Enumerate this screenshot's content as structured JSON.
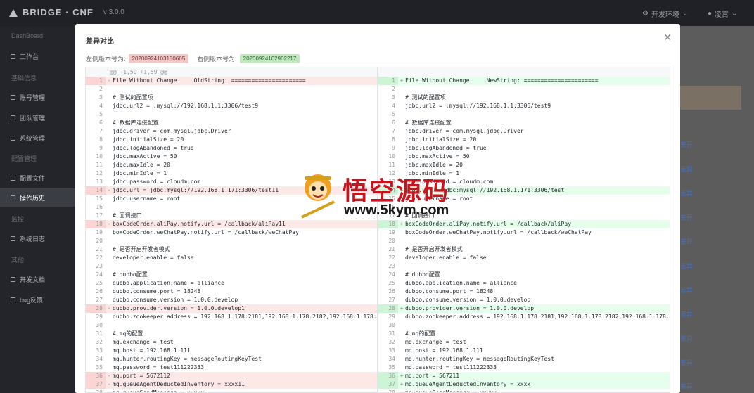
{
  "app": {
    "name": "BRIDGE · CNF",
    "version": "v 3.0.0"
  },
  "topbar": {
    "env_label": "开发环境",
    "user_label": "凌霄"
  },
  "sidebar": {
    "groups": [
      {
        "label": "DashBoard",
        "items": [
          {
            "label": "工作台",
            "icon": "desktop-icon"
          }
        ]
      },
      {
        "label": "基础信息",
        "items": [
          {
            "label": "账号管理",
            "icon": "user-icon"
          },
          {
            "label": "团队管理",
            "icon": "team-icon"
          },
          {
            "label": "系统管理",
            "icon": "file-icon"
          }
        ]
      },
      {
        "label": "配置管理",
        "items": [
          {
            "label": "配置文件",
            "icon": "folder-icon"
          },
          {
            "label": "操作历史",
            "icon": "history-icon",
            "active": true
          }
        ]
      },
      {
        "label": "监控",
        "items": [
          {
            "label": "系统日志",
            "icon": "log-icon"
          }
        ]
      },
      {
        "label": "其他",
        "items": [
          {
            "label": "开发文档",
            "icon": "book-icon"
          },
          {
            "label": "bug反馈",
            "icon": "bug-icon"
          }
        ]
      }
    ]
  },
  "background": {
    "link_label": "差异"
  },
  "modal": {
    "title": "差异对比",
    "left_label": "左侧版本号为:",
    "left_version": "20200924103150665",
    "right_label": "右侧版本号为:",
    "right_version": "20200924102902217",
    "hunk_header": "@@ -1,59 +1,59 @@"
  },
  "diff": {
    "left": [
      {
        "n": "1",
        "t": "del",
        "c": "File Without Change     OldString: ======================"
      },
      {
        "n": "2",
        "t": "ctx",
        "c": ""
      },
      {
        "n": "3",
        "t": "ctx",
        "c": "# 测试的配置项"
      },
      {
        "n": "4",
        "t": "ctx",
        "c": "jdbc.url2 = :mysql://192.168.1.1:3306/test9"
      },
      {
        "n": "5",
        "t": "ctx",
        "c": ""
      },
      {
        "n": "6",
        "t": "ctx",
        "c": "# 数据库连接配置"
      },
      {
        "n": "7",
        "t": "ctx",
        "c": "jdbc.driver = com.mysql.jdbc.Driver"
      },
      {
        "n": "8",
        "t": "ctx",
        "c": "jdbc.initialSize = 20"
      },
      {
        "n": "9",
        "t": "ctx",
        "c": "jdbc.logAbandoned = true"
      },
      {
        "n": "10",
        "t": "ctx",
        "c": "jdbc.maxActive = 50"
      },
      {
        "n": "11",
        "t": "ctx",
        "c": "jdbc.maxIdle = 20"
      },
      {
        "n": "12",
        "t": "ctx",
        "c": "jdbc.minIdle = 1"
      },
      {
        "n": "13",
        "t": "ctx",
        "c": "jdbc.password = cloudm.com"
      },
      {
        "n": "14",
        "t": "del",
        "c": "jdbc.url = jdbc:mysql://192.168.1.171:3306/test11"
      },
      {
        "n": "15",
        "t": "ctx",
        "c": "jdbc.username = root"
      },
      {
        "n": "16",
        "t": "ctx",
        "c": ""
      },
      {
        "n": "17",
        "t": "ctx",
        "c": "# 回调接口"
      },
      {
        "n": "18",
        "t": "del",
        "c": "boxCodeOrder.aliPay.notify.url = /callback/aliPay11"
      },
      {
        "n": "19",
        "t": "ctx",
        "c": "boxCodeOrder.weChatPay.notify.url = /callback/weChatPay"
      },
      {
        "n": "20",
        "t": "ctx",
        "c": ""
      },
      {
        "n": "21",
        "t": "ctx",
        "c": "# 是否开启开发者模式"
      },
      {
        "n": "22",
        "t": "ctx",
        "c": "developer.enable = false"
      },
      {
        "n": "23",
        "t": "ctx",
        "c": ""
      },
      {
        "n": "24",
        "t": "ctx",
        "c": "# dubbo配置"
      },
      {
        "n": "25",
        "t": "ctx",
        "c": "dubbo.application.name = alliance"
      },
      {
        "n": "26",
        "t": "ctx",
        "c": "dubbo.consume.port = 18248"
      },
      {
        "n": "27",
        "t": "ctx",
        "c": "dubbo.consume.version = 1.0.0.develop"
      },
      {
        "n": "28",
        "t": "del",
        "c": "dubbo.provider.version = 1.0.0.develop1"
      },
      {
        "n": "29",
        "t": "ctx",
        "c": "dubbo.zookeeper.address = 192.168.1.178:2181,192.168.1.178:2182,192.168.1.178:2"
      },
      {
        "n": "30",
        "t": "ctx",
        "c": ""
      },
      {
        "n": "31",
        "t": "ctx",
        "c": "# mq的配置"
      },
      {
        "n": "32",
        "t": "ctx",
        "c": "mq.exchange = test"
      },
      {
        "n": "33",
        "t": "ctx",
        "c": "mq.host = 192.168.1.111"
      },
      {
        "n": "34",
        "t": "ctx",
        "c": "mq.hunter.routingKey = messageRoutingKeyTest"
      },
      {
        "n": "35",
        "t": "ctx",
        "c": "mq.password = test111222333"
      },
      {
        "n": "36",
        "t": "del",
        "c": "mq.port = 5672112"
      },
      {
        "n": "37",
        "t": "del",
        "c": "mq.queueAgentDeductedInventory = xxxx11"
      },
      {
        "n": "38",
        "t": "ctx",
        "c": "mq.queueSendMessage = xxxxx"
      }
    ],
    "right": [
      {
        "n": "1",
        "t": "add",
        "c": "File Without Change     NewString: ======================"
      },
      {
        "n": "2",
        "t": "ctx",
        "c": ""
      },
      {
        "n": "3",
        "t": "ctx",
        "c": "# 测试的配置项"
      },
      {
        "n": "4",
        "t": "ctx",
        "c": "jdbc.url2 = :mysql://192.168.1.1:3306/test9"
      },
      {
        "n": "5",
        "t": "ctx",
        "c": ""
      },
      {
        "n": "6",
        "t": "ctx",
        "c": "# 数据库连接配置"
      },
      {
        "n": "7",
        "t": "ctx",
        "c": "jdbc.driver = com.mysql.jdbc.Driver"
      },
      {
        "n": "8",
        "t": "ctx",
        "c": "jdbc.initialSize = 20"
      },
      {
        "n": "9",
        "t": "ctx",
        "c": "jdbc.logAbandoned = true"
      },
      {
        "n": "10",
        "t": "ctx",
        "c": "jdbc.maxActive = 50"
      },
      {
        "n": "11",
        "t": "ctx",
        "c": "jdbc.maxIdle = 20"
      },
      {
        "n": "12",
        "t": "ctx",
        "c": "jdbc.minIdle = 1"
      },
      {
        "n": "13",
        "t": "ctx",
        "c": "jdbc.password = cloudm.com"
      },
      {
        "n": "14",
        "t": "add",
        "c": "jdbc.url = jdbc:mysql://192.168.1.171:3306/test"
      },
      {
        "n": "15",
        "t": "ctx",
        "c": "jdbc.username = root"
      },
      {
        "n": "16",
        "t": "ctx",
        "c": ""
      },
      {
        "n": "17",
        "t": "ctx",
        "c": "# 回调接口"
      },
      {
        "n": "18",
        "t": "add",
        "c": "boxCodeOrder.aliPay.notify.url = /callback/aliPay"
      },
      {
        "n": "19",
        "t": "ctx",
        "c": "boxCodeOrder.weChatPay.notify.url = /callback/weChatPay"
      },
      {
        "n": "20",
        "t": "ctx",
        "c": ""
      },
      {
        "n": "21",
        "t": "ctx",
        "c": "# 是否开启开发者模式"
      },
      {
        "n": "22",
        "t": "ctx",
        "c": "developer.enable = false"
      },
      {
        "n": "23",
        "t": "ctx",
        "c": ""
      },
      {
        "n": "24",
        "t": "ctx",
        "c": "# dubbo配置"
      },
      {
        "n": "25",
        "t": "ctx",
        "c": "dubbo.application.name = alliance"
      },
      {
        "n": "26",
        "t": "ctx",
        "c": "dubbo.consume.port = 18248"
      },
      {
        "n": "27",
        "t": "ctx",
        "c": "dubbo.consume.version = 1.0.0.develop"
      },
      {
        "n": "28",
        "t": "add",
        "c": "dubbo.provider.version = 1.0.0.develop"
      },
      {
        "n": "29",
        "t": "ctx",
        "c": "dubbo.zookeeper.address = 192.168.1.178:2181,192.168.1.178:2182,192.168.1.178:2"
      },
      {
        "n": "30",
        "t": "ctx",
        "c": ""
      },
      {
        "n": "31",
        "t": "ctx",
        "c": "# mq的配置"
      },
      {
        "n": "32",
        "t": "ctx",
        "c": "mq.exchange = test"
      },
      {
        "n": "33",
        "t": "ctx",
        "c": "mq.host = 192.168.1.111"
      },
      {
        "n": "34",
        "t": "ctx",
        "c": "mq.hunter.routingKey = messageRoutingKeyTest"
      },
      {
        "n": "35",
        "t": "ctx",
        "c": "mq.password = test111222333"
      },
      {
        "n": "36",
        "t": "add",
        "c": "mq.port = 567211"
      },
      {
        "n": "37",
        "t": "add",
        "c": "mq.queueAgentDeductedInventory = xxxx"
      },
      {
        "n": "38",
        "t": "ctx",
        "c": "mq.queueSendMessage = xxxxx"
      }
    ]
  },
  "watermark": {
    "cn": "悟空源码",
    "url": "www.5kym.com"
  }
}
